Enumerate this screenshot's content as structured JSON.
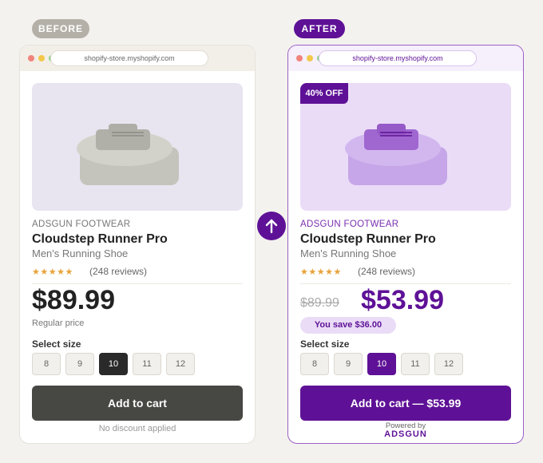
{
  "labels": {
    "before": "BEFORE",
    "after": "AFTER"
  },
  "url": "shopify-store.myshopify.com",
  "product": {
    "brand": "ADSGUN FOOTWEAR",
    "name": "Cloudstep Runner Pro",
    "category": "Men's Running Shoe",
    "stars": "★★★★★",
    "reviews": "(248 reviews)"
  },
  "sizes": {
    "label": "Select size",
    "options": [
      "8",
      "9",
      "10",
      "11",
      "12"
    ],
    "selected": "10"
  },
  "before": {
    "price": "$89.99",
    "price_note": "Regular price",
    "cart_label": "Add to cart",
    "footer_note": "No discount applied"
  },
  "after": {
    "badge": "40% OFF",
    "old_price": "$89.99",
    "price": "$53.99",
    "savings": "You save $36.00",
    "cart_label": "Add to cart — $53.99",
    "powered_by": "Powered by",
    "powered_brand": "ADSGUN"
  },
  "colors": {
    "accent": "#5e1196",
    "before_button": "#474743",
    "star": "#e8a23a"
  },
  "icons": {
    "transition": "arrow-up-icon",
    "product": "sneaker-icon"
  }
}
